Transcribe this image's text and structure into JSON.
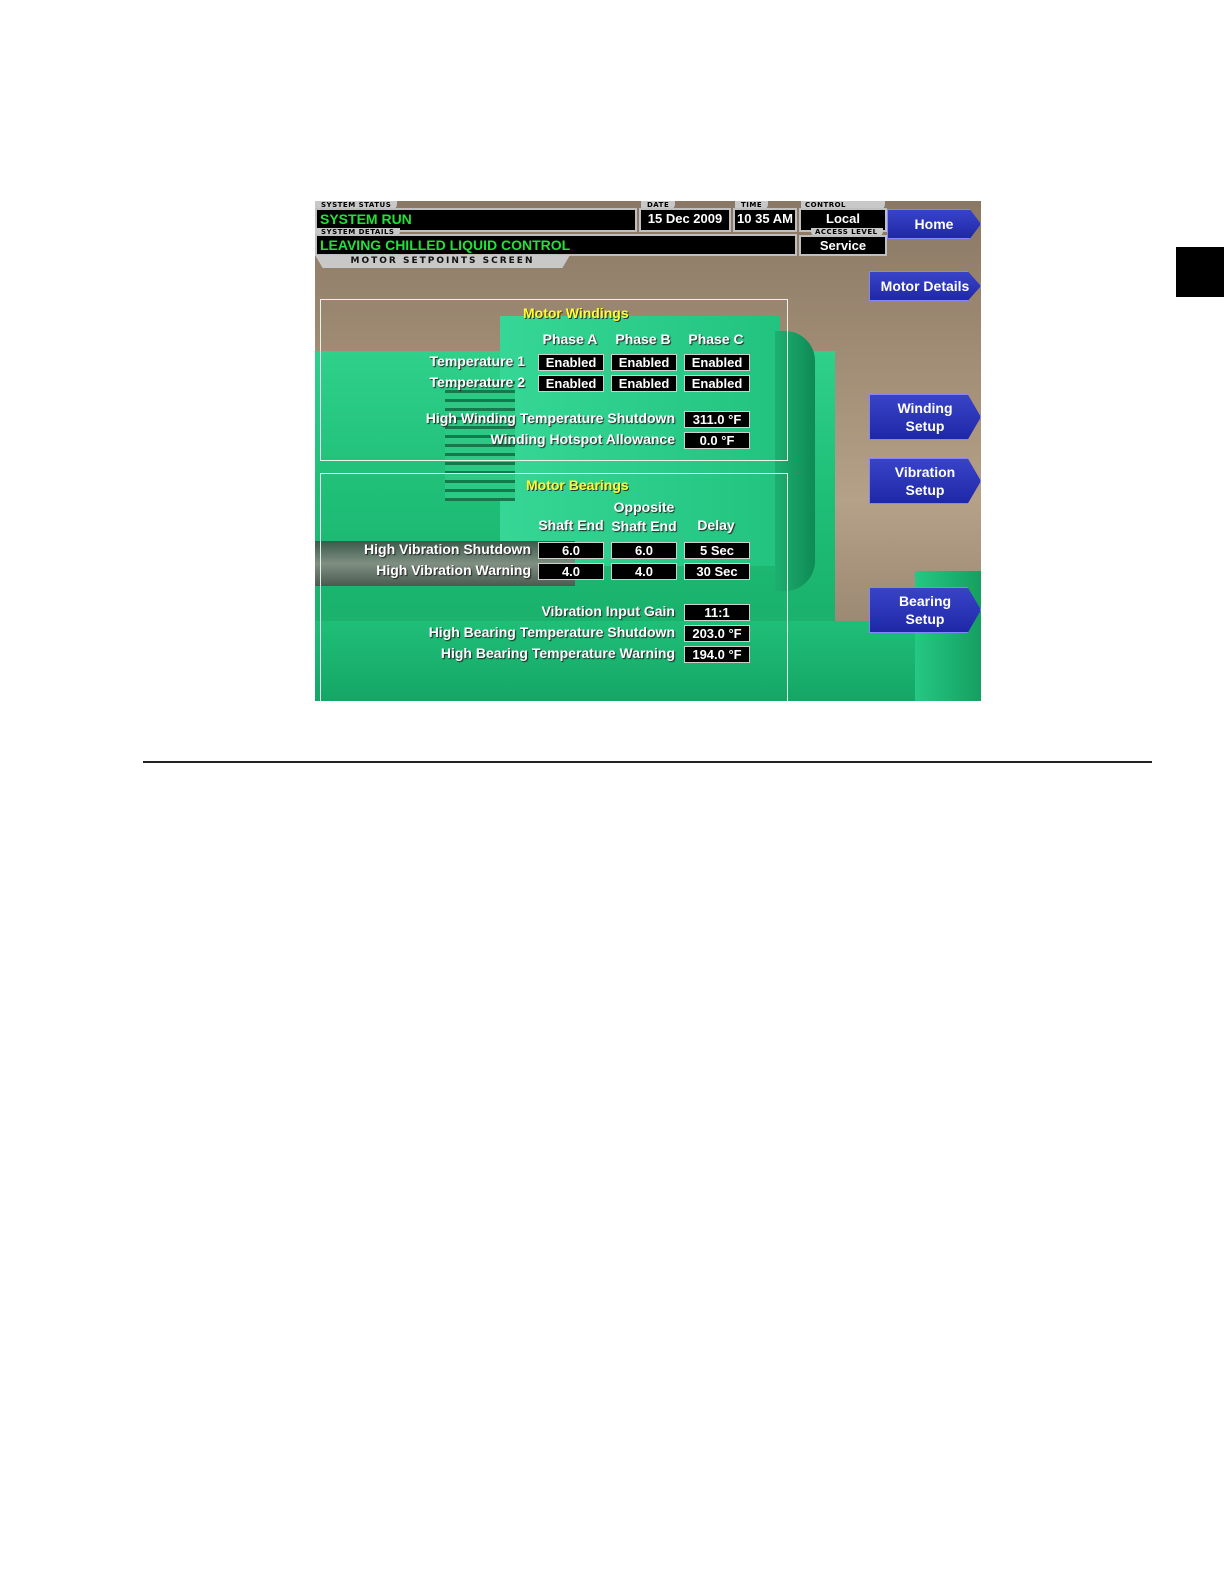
{
  "header": {
    "system_status_tag": "SYSTEM STATUS",
    "system_status": "SYSTEM RUN",
    "system_details_tag": "SYSTEM DETAILS",
    "system_details": "LEAVING CHILLED LIQUID CONTROL",
    "date_tag": "DATE",
    "date": "15 Dec 2009",
    "time_tag": "TIME",
    "time": "10 35 AM",
    "control_source_tag": "CONTROL SOURCE",
    "control_source": "Local",
    "access_level_tag": "ACCESS LEVEL",
    "access_level": "Service",
    "screen_title": "MOTOR SETPOINTS SCREEN"
  },
  "nav": {
    "home": "Home",
    "motor_details": "Motor Details",
    "winding_setup_1": "Winding",
    "winding_setup_2": "Setup",
    "vibration_setup_1": "Vibration",
    "vibration_setup_2": "Setup",
    "bearing_setup_1": "Bearing",
    "bearing_setup_2": "Setup"
  },
  "windings": {
    "title": "Motor Windings",
    "columns": [
      "Phase A",
      "Phase B",
      "Phase C"
    ],
    "rows": [
      {
        "label": "Temperature 1",
        "values": [
          "Enabled",
          "Enabled",
          "Enabled"
        ]
      },
      {
        "label": "Temperature 2",
        "values": [
          "Enabled",
          "Enabled",
          "Enabled"
        ]
      }
    ],
    "shutdown_label": "High Winding Temperature Shutdown",
    "shutdown_value": "311.0 °F",
    "hotspot_label": "Winding Hotspot Allowance",
    "hotspot_value": "0.0 °F"
  },
  "bearings": {
    "title": "Motor Bearings",
    "col_shaft_end": "Shaft End",
    "col_opposite_1": "Opposite",
    "col_opposite_2": "Shaft End",
    "col_delay": "Delay",
    "rows": [
      {
        "label": "High Vibration Shutdown",
        "values": [
          "6.0",
          "6.0",
          "5 Sec"
        ]
      },
      {
        "label": "High Vibration Warning",
        "values": [
          "4.0",
          "4.0",
          "30 Sec"
        ]
      }
    ],
    "gain_label": "Vibration Input Gain",
    "gain_value": "11:1",
    "temp_shutdown_label": "High Bearing Temperature Shutdown",
    "temp_shutdown_value": "203.0 °F",
    "temp_warning_label": "High Bearing Temperature Warning",
    "temp_warning_value": "194.0 °F"
  }
}
